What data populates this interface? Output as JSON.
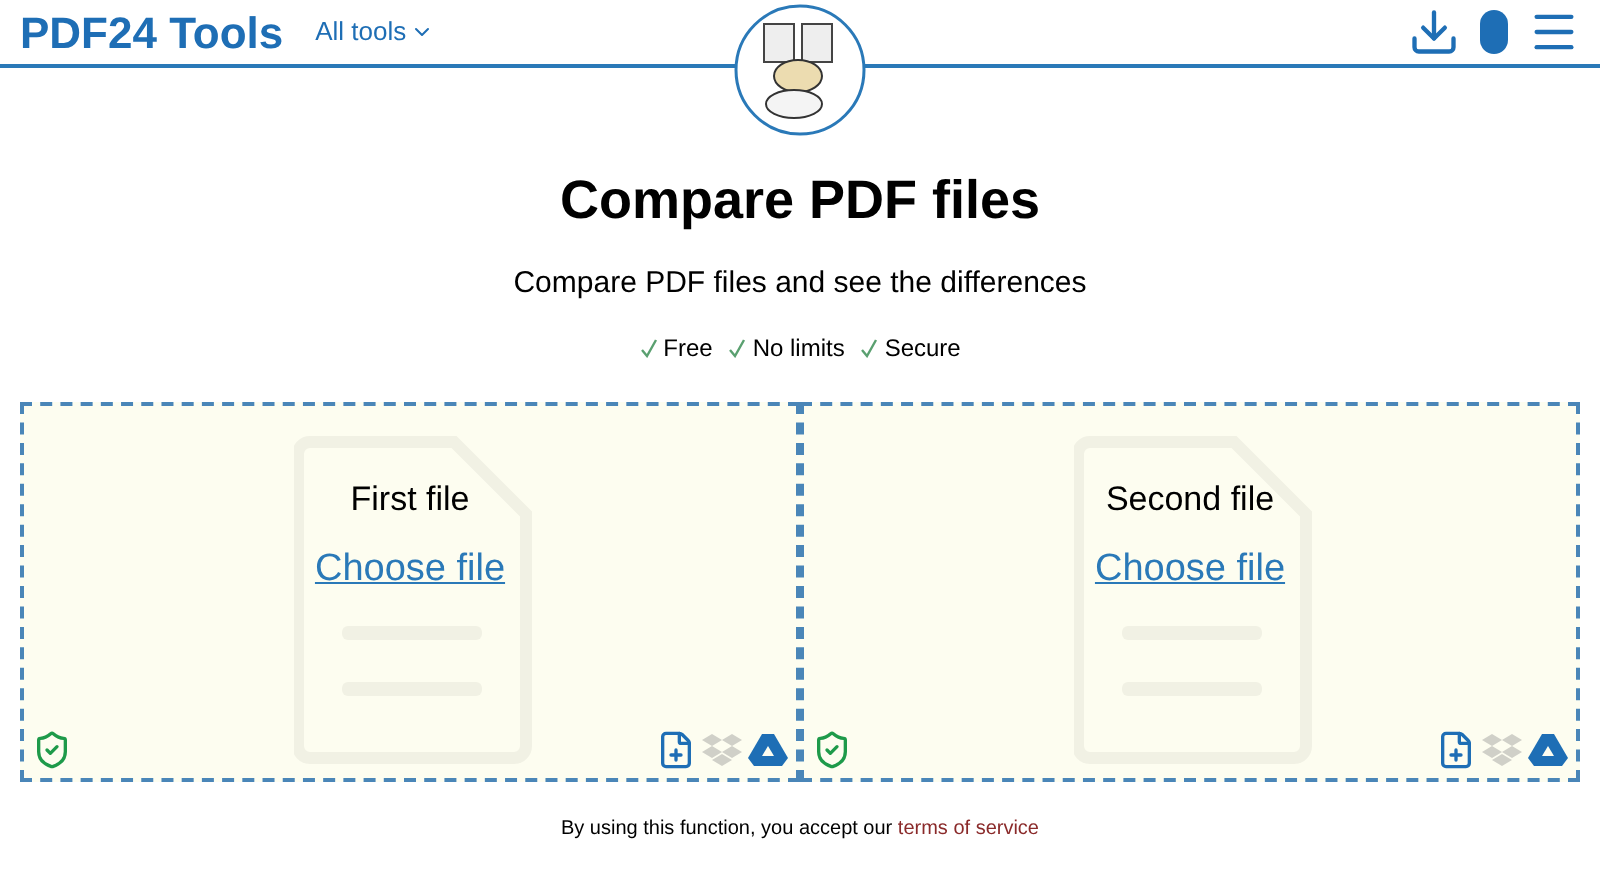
{
  "header": {
    "brand": "PDF24 Tools",
    "menu_label": "All tools"
  },
  "title": "Compare PDF files",
  "subtitle": "Compare PDF files and see the differences",
  "features": [
    "Free",
    "No limits",
    "Secure"
  ],
  "dropzones": [
    {
      "label": "First file",
      "action": "Choose file"
    },
    {
      "label": "Second file",
      "action": "Choose file"
    }
  ],
  "footer": {
    "text": "By using this function, you accept our ",
    "link": "terms of service"
  }
}
